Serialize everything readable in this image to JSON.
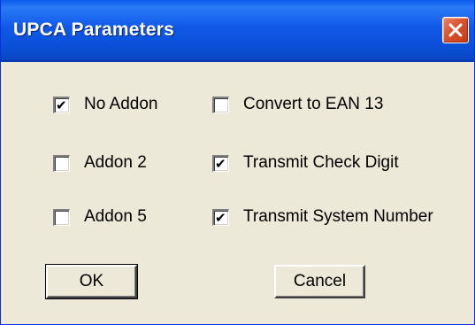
{
  "window": {
    "title": "UPCA Parameters",
    "close_icon": "close-icon"
  },
  "options": {
    "no_addon": {
      "label": "No Addon",
      "checked": true
    },
    "addon_2": {
      "label": "Addon 2",
      "checked": false
    },
    "addon_5": {
      "label": "Addon 5",
      "checked": false
    },
    "convert_ean13": {
      "label": "Convert to EAN 13",
      "checked": false
    },
    "transmit_check_digit": {
      "label": "Transmit Check Digit",
      "checked": true
    },
    "transmit_system_number": {
      "label": "Transmit System Number",
      "checked": true
    }
  },
  "buttons": {
    "ok": "OK",
    "cancel": "Cancel"
  },
  "colors": {
    "titlebar": "#0A5BEA",
    "dialog_bg": "#ECE9D8",
    "close_button": "#D9532E"
  }
}
